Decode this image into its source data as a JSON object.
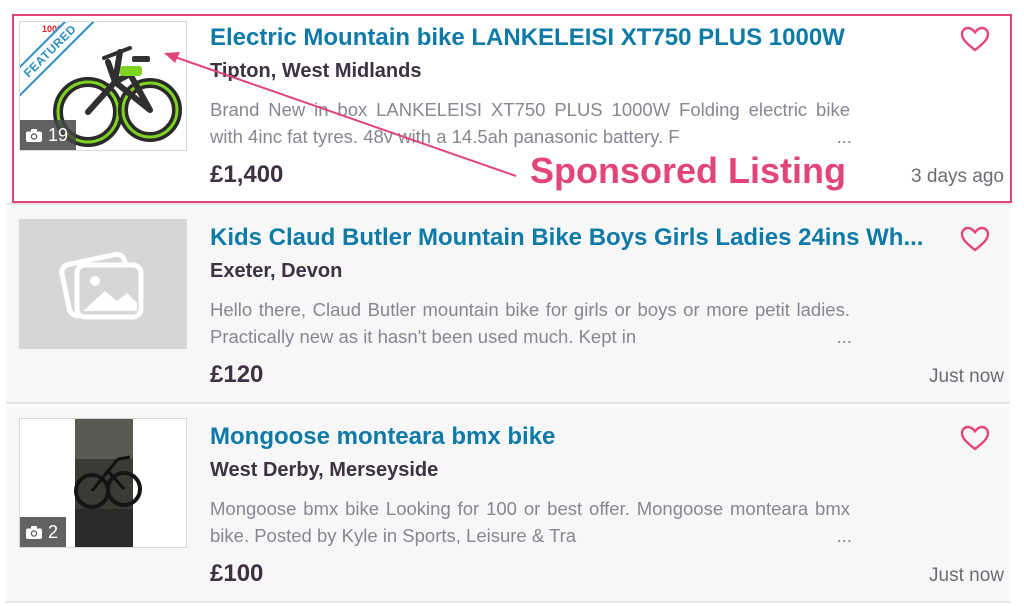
{
  "listings": [
    {
      "title": "Electric Mountain bike LANKELEISI XT750 PLUS 1000W",
      "location": "Tipton, West Midlands",
      "description": "Brand New in box LANKELEISI XT750 PLUS 1000W Folding electric bike with 4inc fat tyres. 48v with a 14.5ah panasonic battery. F",
      "price": "£1,400",
      "posted": "3 days ago",
      "photo_count": "19",
      "badge": "FEATURED",
      "thumb_badge_text": "1000",
      "image_icon": "electric-fat-tyre-bike-photo"
    },
    {
      "title": "Kids Claud Butler Mountain Bike Boys Girls Ladies 24ins Wh...",
      "location": "Exeter, Devon",
      "description": "Hello there, Claud Butler mountain bike for girls or boys or more petit ladies. Practically new as it hasn't been used much. Kept in",
      "price": "£120",
      "posted": "Just now",
      "image_icon": "image-placeholder-icon"
    },
    {
      "title": "Mongoose monteara bmx bike",
      "location": "West Derby, Merseyside",
      "description": "Mongoose bmx bike Looking for 100 or best offer. Mongoose monteara bmx bike. Posted by Kyle in Sports, Leisure & Tra",
      "price": "£100",
      "posted": "Just now",
      "photo_count": "2",
      "image_icon": "bmx-bike-photo"
    }
  ],
  "ellipsis": "...",
  "annotation": {
    "label": "Sponsored Listing",
    "color": "#e2457a"
  },
  "colors": {
    "title": "#0e7aa8",
    "heart": "#e2457a",
    "featured": "#2b8fc5"
  },
  "icons": {
    "favourite": "heart-outline-icon",
    "photos": "camera-icon"
  }
}
